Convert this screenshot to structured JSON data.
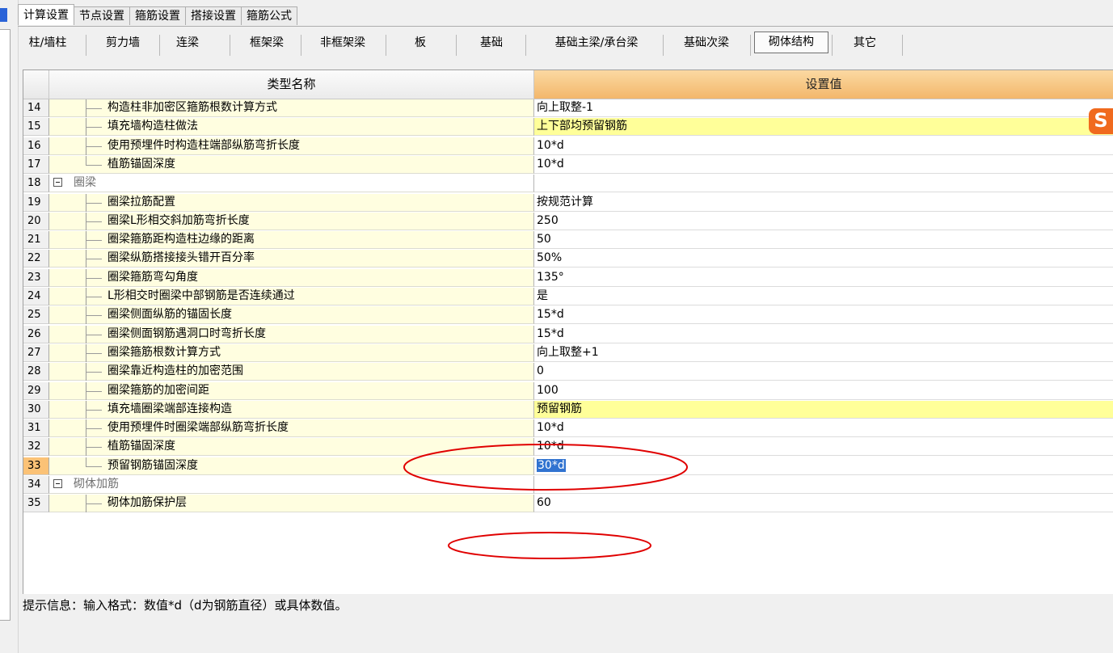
{
  "top_tabs": [
    "计算设置",
    "节点设置",
    "箍筋设置",
    "搭接设置",
    "箍筋公式"
  ],
  "sub_tabs": [
    "柱/墙柱",
    "剪力墙",
    "连梁",
    "框架梁",
    "非框架梁",
    "板",
    "基础",
    "基础主梁/承台梁",
    "基础次梁",
    "砌体结构",
    "其它"
  ],
  "table": {
    "headers": {
      "name": "类型名称",
      "value": "设置值"
    },
    "rows": [
      {
        "num": "14",
        "name": "构造柱非加密区箍筋根数计算方式",
        "value": "向上取整-1"
      },
      {
        "num": "15",
        "name": "填充墙构造柱做法",
        "value": "上下部均预留钢筋"
      },
      {
        "num": "16",
        "name": "使用预埋件时构造柱端部纵筋弯折长度",
        "value": "10*d"
      },
      {
        "num": "17",
        "name": "植筋锚固深度",
        "value": "10*d"
      },
      {
        "num": "18",
        "name": "圈梁",
        "value": ""
      },
      {
        "num": "19",
        "name": "圈梁拉筋配置",
        "value": "按规范计算"
      },
      {
        "num": "20",
        "name": "圈梁L形相交斜加筋弯折长度",
        "value": "250"
      },
      {
        "num": "21",
        "name": "圈梁箍筋距构造柱边缘的距离",
        "value": "50"
      },
      {
        "num": "22",
        "name": "圈梁纵筋搭接接头错开百分率",
        "value": "50%"
      },
      {
        "num": "23",
        "name": "圈梁箍筋弯勾角度",
        "value": "135°"
      },
      {
        "num": "24",
        "name": "L形相交时圈梁中部钢筋是否连续通过",
        "value": "是"
      },
      {
        "num": "25",
        "name": "圈梁侧面纵筋的锚固长度",
        "value": "15*d"
      },
      {
        "num": "26",
        "name": "圈梁侧面钢筋遇洞口时弯折长度",
        "value": "15*d"
      },
      {
        "num": "27",
        "name": "圈梁箍筋根数计算方式",
        "value": "向上取整+1"
      },
      {
        "num": "28",
        "name": "圈梁靠近构造柱的加密范围",
        "value": "0"
      },
      {
        "num": "29",
        "name": "圈梁箍筋的加密间距",
        "value": "100"
      },
      {
        "num": "30",
        "name": "填充墙圈梁端部连接构造",
        "value": "预留钢筋"
      },
      {
        "num": "31",
        "name": "使用预埋件时圈梁端部纵筋弯折长度",
        "value": "10*d"
      },
      {
        "num": "32",
        "name": "植筋锚固深度",
        "value": "10*d"
      },
      {
        "num": "33",
        "name": "预留钢筋锚固深度",
        "value": "30*d"
      },
      {
        "num": "34",
        "name": "砌体加筋",
        "value": ""
      },
      {
        "num": "35",
        "name": "砌体加筋保护层",
        "value": "60"
      }
    ]
  },
  "hint": "提示信息：输入格式：数值*d（d为钢筋直径）或具体数值。",
  "colors": {
    "header_value": "#f3b76b",
    "name_cell": "#fffee0",
    "highlight": "#ffff99",
    "selected_row": "#fbc276",
    "annotation": "#e00000"
  },
  "icons": {
    "brand": "sogou-s-icon"
  },
  "brand_letter": "S"
}
